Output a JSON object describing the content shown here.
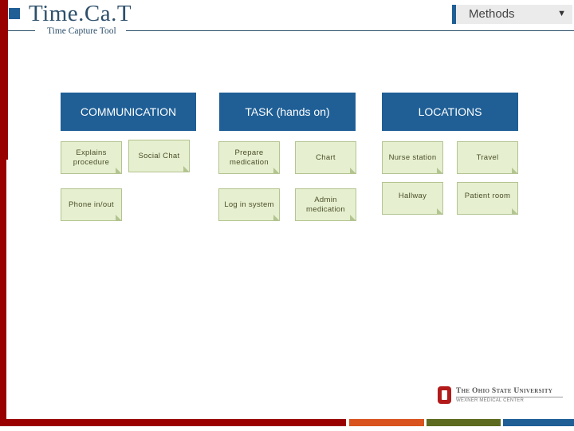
{
  "header": {
    "title": "Time.Ca.T",
    "subtitle": "Time Capture Tool",
    "dropdown": {
      "selected": "Methods",
      "caret_icon": "▼"
    }
  },
  "categories": [
    {
      "label": "COMMUNICATION",
      "items": [
        "Explains procedure",
        "Social Chat",
        "Phone in/out"
      ]
    },
    {
      "label": "TASK (hands on)",
      "items": [
        "Prepare medication",
        "Chart",
        "Log in system",
        "Admin medication"
      ]
    },
    {
      "label": "LOCATIONS",
      "items": [
        "Nurse station",
        "Travel",
        "Hallway",
        "Patient room"
      ]
    }
  ],
  "footer": {
    "logo_line1": "The Ohio State University",
    "logo_line2": "WEXNER MEDICAL CENTER"
  },
  "colors": {
    "accent_red": "#990000",
    "accent_blue": "#1f5f96",
    "accent_orange": "#d9531e",
    "accent_green": "#5c6b20",
    "card_fill": "#e6efcf"
  }
}
